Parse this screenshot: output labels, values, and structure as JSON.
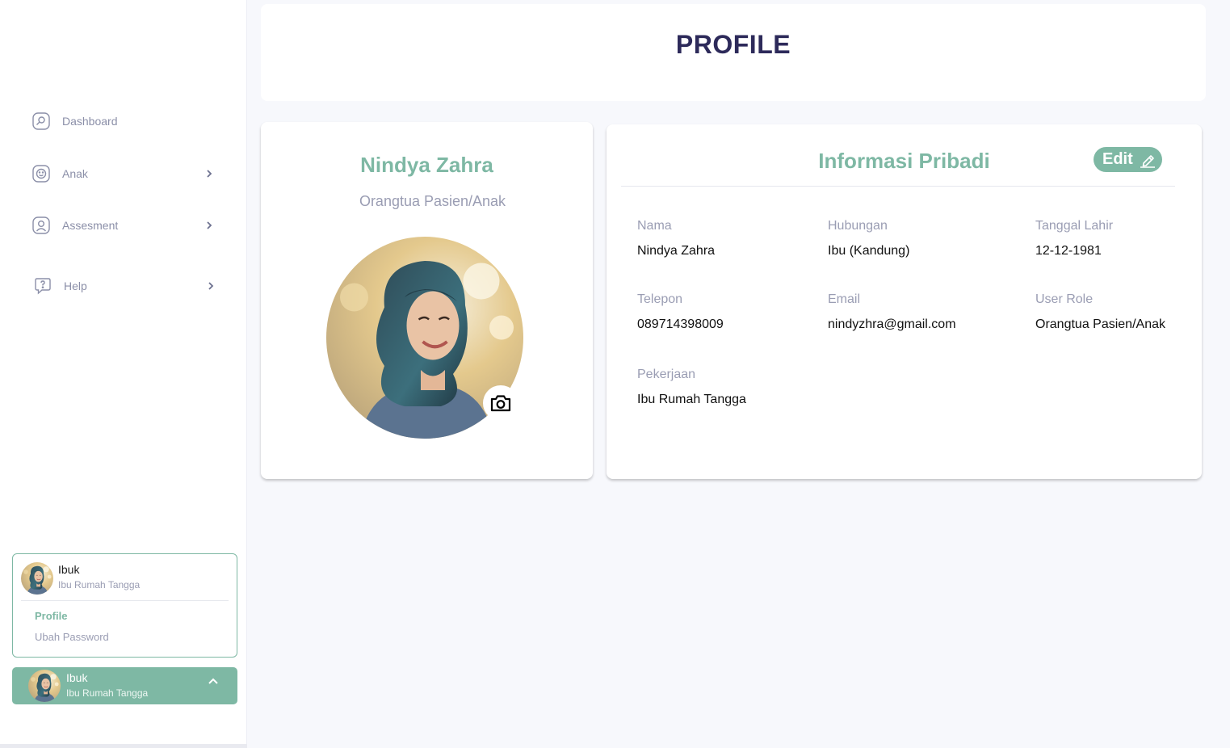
{
  "sidebar": {
    "items": [
      {
        "label": "Dashboard",
        "icon": "dashboard-icon"
      },
      {
        "label": "Anak",
        "icon": "child-face-icon"
      },
      {
        "label": "Assesment",
        "icon": "assessment-user-icon"
      },
      {
        "label": "Help",
        "icon": "help-icon"
      }
    ],
    "user_menu": {
      "name": "Ibuk",
      "role": "Ibu Rumah Tangga",
      "links": [
        "Profile",
        "Ubah Password"
      ]
    },
    "user_chip": {
      "name": "Ibuk",
      "role": "Ibu Rumah Tangga"
    }
  },
  "header": {
    "title": "PROFILE"
  },
  "profile_card": {
    "name": "Nindya Zahra",
    "role": "Orangtua Pasien/Anak"
  },
  "info": {
    "title": "Informasi Pribadi",
    "edit_label": "Edit",
    "fields": [
      {
        "label": "Nama",
        "value": "Nindya Zahra"
      },
      {
        "label": "Hubungan",
        "value": "Ibu (Kandung)"
      },
      {
        "label": "Tanggal Lahir",
        "value": "12-12-1981"
      },
      {
        "label": "Telepon",
        "value": "089714398009"
      },
      {
        "label": "Email",
        "value": "nindyzhra@gmail.com"
      },
      {
        "label": "User Role",
        "value": "Orangtua Pasien/Anak"
      },
      {
        "label": "Pekerjaan",
        "value": "Ibu Rumah Tangga"
      }
    ]
  },
  "colors": {
    "accent": "#7eb8a4",
    "title": "#2d2a5a",
    "muted": "#9a9db3"
  }
}
